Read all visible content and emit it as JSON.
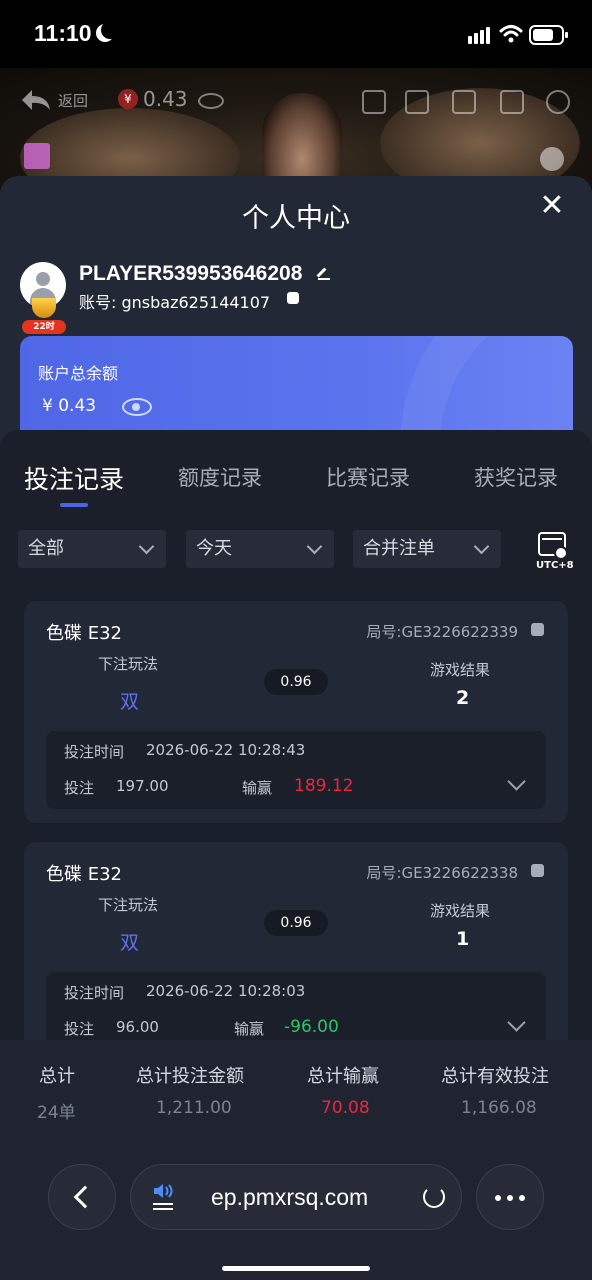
{
  "status_bar": {
    "time": "11:10"
  },
  "video_bar": {
    "back_label": "返回",
    "balance": "0.43",
    "currency_symbol": "¥"
  },
  "sheet": {
    "title": "个人中心",
    "close_symbol": "✕"
  },
  "profile": {
    "player_name": "PLAYER539953646208",
    "account_label": "账号: gnsbaz625144107",
    "badge_text": "22时"
  },
  "balance_card": {
    "label": "账户总余额",
    "value": "¥ 0.43"
  },
  "tabs": [
    {
      "label": "投注记录",
      "active": true
    },
    {
      "label": "额度记录",
      "active": false
    },
    {
      "label": "比赛记录",
      "active": false
    },
    {
      "label": "获奖记录",
      "active": false
    }
  ],
  "filters": {
    "type": "全部",
    "date": "今天",
    "merge": "合并注单",
    "timezone": "UTC+8"
  },
  "bets": [
    {
      "game": "色碟 E32",
      "round": "局号:GE3226622339",
      "pick_label": "下注玩法",
      "pick": "双",
      "odds": "0.96",
      "result_label": "游戏结果",
      "result": "2",
      "time_label": "投注时间",
      "time": "2026-06-22 10:28:43",
      "stake_label": "投注",
      "stake": "197.00",
      "winloss_label": "输赢",
      "winloss": "189.12",
      "winloss_color": "#e8283e"
    },
    {
      "game": "色碟 E32",
      "round": "局号:GE3226622338",
      "pick_label": "下注玩法",
      "pick": "双",
      "odds": "0.96",
      "result_label": "游戏结果",
      "result": "1",
      "time_label": "投注时间",
      "time": "2026-06-22 10:28:03",
      "stake_label": "投注",
      "stake": "96.00",
      "winloss_label": "输赢",
      "winloss": "-96.00",
      "winloss_color": "#2ec46a"
    }
  ],
  "totals": {
    "count_label": "总计",
    "count": "24单",
    "amount_label": "总计投注金额",
    "amount": "1,211.00",
    "winloss_label": "总计输赢",
    "winloss": "70.08",
    "valid_label": "总计有效投注",
    "valid": "1,166.08"
  },
  "browser": {
    "url": "ep.pmxrsq.com"
  },
  "colors": {
    "accent": "#4b63e6",
    "loss": "#2ec46a",
    "win": "#e8283e"
  }
}
